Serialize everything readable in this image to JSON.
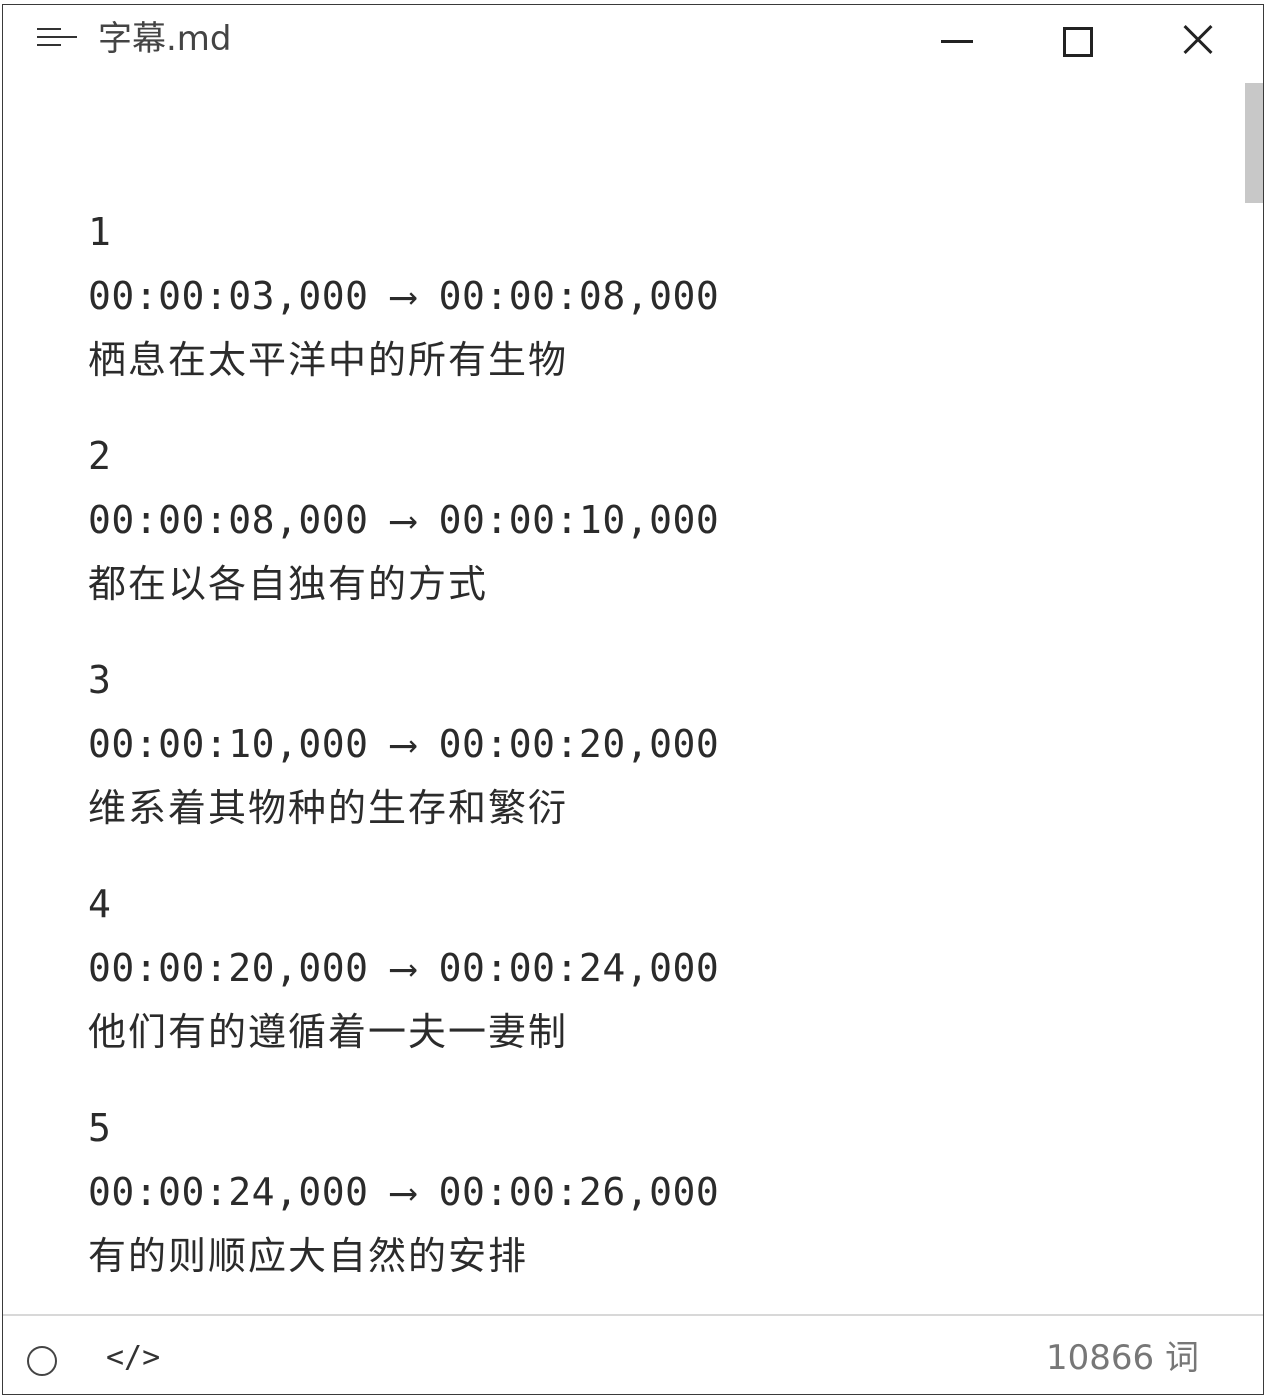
{
  "titlebar": {
    "title": "字幕.md",
    "menu_icon": "hamburger-menu-icon",
    "minimize_icon": "minimize-icon",
    "maximize_icon": "maximize-icon",
    "close_icon": "close-icon"
  },
  "entries": [
    {
      "index": "1",
      "timestamp": "00:00:03,000 ⟶ 00:00:08,000",
      "text": "栖息在太平洋中的所有生物"
    },
    {
      "index": "2",
      "timestamp": "00:00:08,000 ⟶ 00:00:10,000",
      "text": "都在以各自独有的方式"
    },
    {
      "index": "3",
      "timestamp": "00:00:10,000 ⟶ 00:00:20,000",
      "text": "维系着其物种的生存和繁衍"
    },
    {
      "index": "4",
      "timestamp": "00:00:20,000 ⟶ 00:00:24,000",
      "text": "他们有的遵循着一夫一妻制"
    },
    {
      "index": "5",
      "timestamp": "00:00:24,000 ⟶ 00:00:26,000",
      "text": "有的则顺应大自然的安排"
    }
  ],
  "statusbar": {
    "code_label": "</>",
    "word_count": "10866 词"
  }
}
